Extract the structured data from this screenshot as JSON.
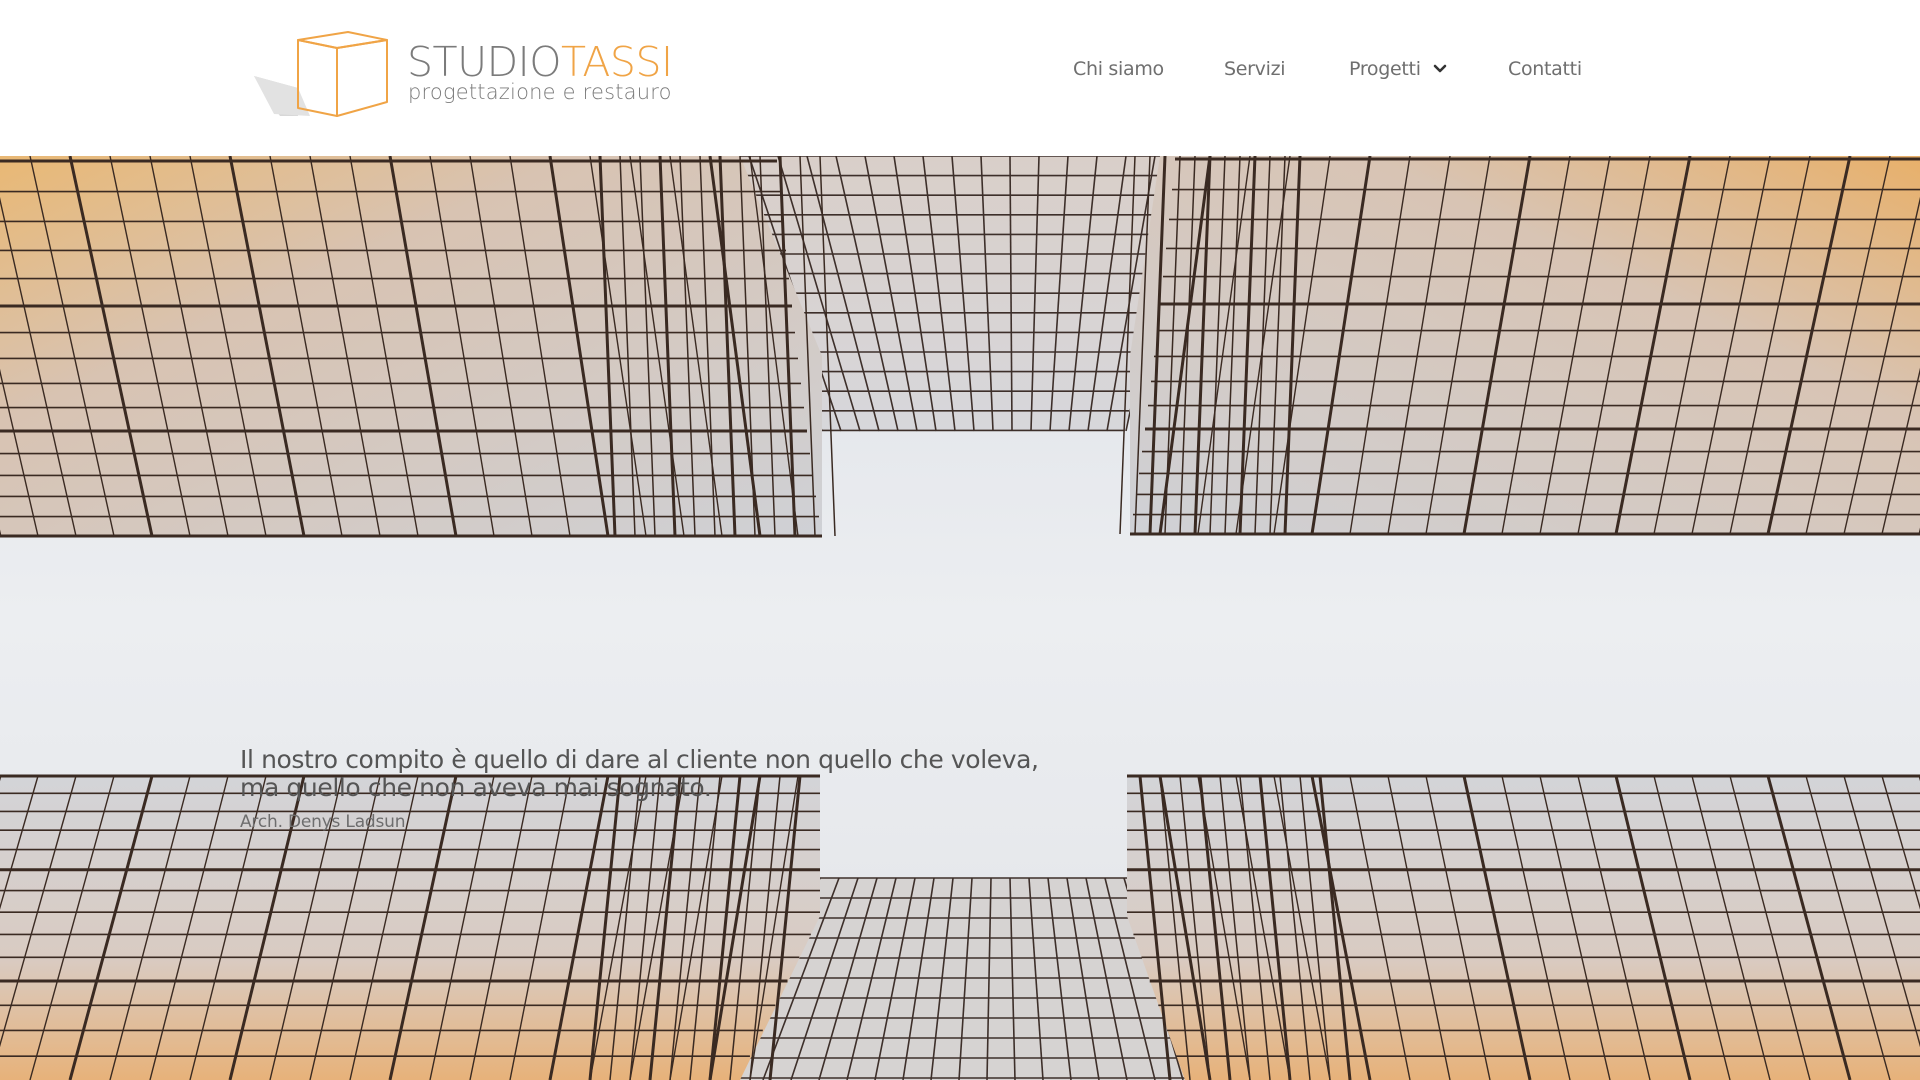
{
  "brand": {
    "name_part1": "STUDIO",
    "name_part2": "TASSI",
    "tagline": "progettazione e restauro",
    "logo_icon": "cube-logo-icon",
    "accent_color": "#f0a446",
    "text_color": "#7b7b7b"
  },
  "nav": {
    "items": [
      {
        "label": "Chi siamo"
      },
      {
        "label": "Servizi"
      },
      {
        "label": "Progetti",
        "has_dropdown": true,
        "icon": "chevron-down-icon"
      },
      {
        "label": "Contatti"
      }
    ]
  },
  "hero": {
    "image": "looking-up-glass-skyscrapers-photo",
    "quote_line1": "Il nostro compito è quello di dare al cliente non quello che voleva,",
    "quote_line2": "ma quello che non aveva mai sognato.",
    "author": "Arch. Denys Ladsun"
  }
}
